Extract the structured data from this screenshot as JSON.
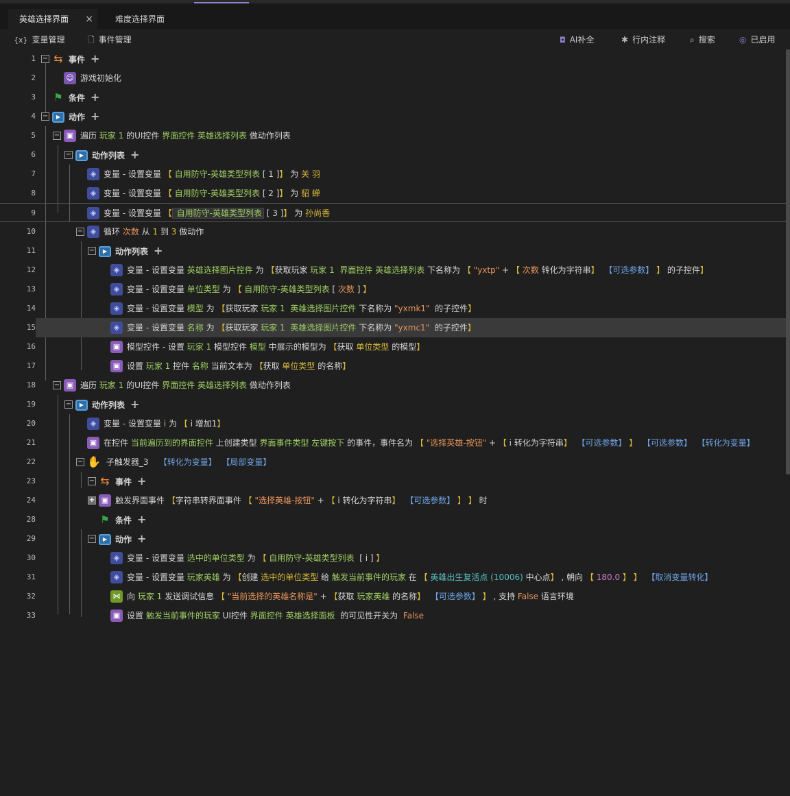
{
  "tabs": [
    {
      "label": "英雄选择界面",
      "active": true,
      "close": "×"
    },
    {
      "label": "难度选择界面",
      "active": false
    }
  ],
  "toolbar": {
    "left": [
      {
        "icon": "variable-icon",
        "glyph": "{x}",
        "label": "变量管理"
      },
      {
        "icon": "event-doc-icon",
        "glyph": "🗋",
        "label": "事件管理"
      }
    ],
    "right": [
      {
        "icon": "ai-robot-icon",
        "glyph": "🤖",
        "label": "AI补全"
      },
      {
        "icon": "asterisk-icon",
        "glyph": "✱",
        "label": "行内注释"
      },
      {
        "icon": "search-icon",
        "glyph": "🔍",
        "label": "搜索"
      },
      {
        "icon": "check-circle-icon",
        "glyph": "✓",
        "label": "已启用"
      }
    ]
  },
  "rows": [
    {
      "ln": "1",
      "depth": 0,
      "toggle": "−",
      "icon": "event",
      "bold": true,
      "add": true,
      "parts": [
        [
          "w",
          "事件"
        ]
      ]
    },
    {
      "ln": "2",
      "depth": 1,
      "icon": "user",
      "parts": [
        [
          "w",
          "游戏初始化"
        ]
      ]
    },
    {
      "ln": "3",
      "depth": 0,
      "icon": "cond",
      "bold": true,
      "add": true,
      "parts": [
        [
          "w",
          "条件"
        ]
      ]
    },
    {
      "ln": "4",
      "depth": 0,
      "toggle": "−",
      "icon": "act",
      "bold": true,
      "add": true,
      "parts": [
        [
          "w",
          "动作"
        ]
      ]
    },
    {
      "ln": "5",
      "depth": 1,
      "toggle": "−",
      "icon": "purple",
      "parts": [
        [
          "w",
          "遍历 "
        ],
        [
          "g",
          "玩家 1"
        ],
        [
          "w",
          " 的UI控件 "
        ],
        [
          "g",
          "界面控件 英雄选择列表"
        ],
        [
          "w",
          " 做动作列表"
        ]
      ]
    },
    {
      "ln": "6",
      "depth": 2,
      "toggle": "−",
      "icon": "act",
      "bold": true,
      "add": true,
      "parts": [
        [
          "w",
          "动作列表"
        ]
      ]
    },
    {
      "ln": "7",
      "depth": 3,
      "icon": "var",
      "parts": [
        [
          "w",
          "变量 - 设置变量 "
        ],
        [
          "y",
          "【"
        ],
        [
          "g",
          " 自用防守-英雄类型列表"
        ],
        [
          "w",
          " [ 1 ]"
        ],
        [
          "y",
          "】"
        ],
        [
          "w",
          " 为 "
        ],
        [
          "y",
          "关 羽"
        ]
      ]
    },
    {
      "ln": "8",
      "depth": 3,
      "icon": "var",
      "parts": [
        [
          "w",
          "变量 - 设置变量 "
        ],
        [
          "y",
          "【"
        ],
        [
          "g",
          " 自用防守-英雄类型列表"
        ],
        [
          "w",
          " [ 2 ]"
        ],
        [
          "y",
          "】"
        ],
        [
          "w",
          " 为 "
        ],
        [
          "y",
          "貂 蝉"
        ]
      ]
    },
    {
      "ln": "9",
      "depth": 3,
      "icon": "var",
      "hover": true,
      "parts": [
        [
          "w",
          "变量 - 设置变量 "
        ],
        [
          "y",
          "【"
        ],
        [
          "g",
          "hl: 自用防守-英雄类型列表"
        ],
        [
          "w",
          " [ 3 ]"
        ],
        [
          "y",
          "】"
        ],
        [
          "w",
          " 为 "
        ],
        [
          "y",
          "孙尚香"
        ]
      ]
    },
    {
      "ln": "10",
      "depth": 3,
      "toggle": "−",
      "icon": "var",
      "parts": [
        [
          "w",
          "循环 "
        ],
        [
          "o",
          "次数"
        ],
        [
          "w",
          " 从 "
        ],
        [
          "y",
          "1"
        ],
        [
          "w",
          " 到 "
        ],
        [
          "y",
          "3"
        ],
        [
          "w",
          " 做动作"
        ]
      ]
    },
    {
      "ln": "11",
      "depth": 4,
      "toggle": "−",
      "icon": "act",
      "bold": true,
      "add": true,
      "parts": [
        [
          "w",
          "动作列表"
        ]
      ]
    },
    {
      "ln": "12",
      "depth": 5,
      "icon": "var",
      "parts": [
        [
          "w",
          "变量 - 设置变量 "
        ],
        [
          "g",
          "英雄选择图片控件"
        ],
        [
          "w",
          " 为 "
        ],
        [
          "y",
          "【"
        ],
        [
          "w",
          "获取玩家 "
        ],
        [
          "g",
          "玩家 1"
        ],
        [
          "w",
          "  "
        ],
        [
          "g",
          "界面控件 英雄选择列表"
        ],
        [
          "w",
          " 下名称为 "
        ],
        [
          "y",
          "【"
        ],
        [
          "o",
          " \"yxtp\""
        ],
        [
          "w",
          " + "
        ],
        [
          "y",
          "【"
        ],
        [
          "o",
          " 次数"
        ],
        [
          "w",
          " 转化为字符串"
        ],
        [
          "y",
          "】"
        ],
        [
          "b",
          "  【可选参数】"
        ],
        [
          "y",
          " 】"
        ],
        [
          "w",
          " 的子控件"
        ],
        [
          "y",
          "】"
        ]
      ]
    },
    {
      "ln": "13",
      "depth": 5,
      "icon": "var",
      "parts": [
        [
          "w",
          "变量 - 设置变量 "
        ],
        [
          "g",
          "单位类型"
        ],
        [
          "w",
          " 为 "
        ],
        [
          "y",
          "【"
        ],
        [
          "g",
          " 自用防守-英雄类型列表"
        ],
        [
          "w",
          " [ "
        ],
        [
          "o",
          "次数"
        ],
        [
          "w",
          " ]"
        ],
        [
          "y",
          " 】"
        ]
      ]
    },
    {
      "ln": "14",
      "depth": 5,
      "icon": "var",
      "parts": [
        [
          "w",
          "变量 - 设置变量 "
        ],
        [
          "g",
          "模型"
        ],
        [
          "w",
          " 为 "
        ],
        [
          "y",
          "【"
        ],
        [
          "w",
          "获取玩家 "
        ],
        [
          "g",
          "玩家 1"
        ],
        [
          "w",
          "  "
        ],
        [
          "g",
          "英雄选择图片控件"
        ],
        [
          "w",
          " 下名称为 "
        ],
        [
          "o",
          "\"yxmk1\""
        ],
        [
          "w",
          "  的子控件"
        ],
        [
          "y",
          "】"
        ]
      ]
    },
    {
      "ln": "15",
      "depth": 5,
      "icon": "var",
      "selected": true,
      "parts": [
        [
          "w",
          "变量 - 设置变量 "
        ],
        [
          "g",
          "名称"
        ],
        [
          "w",
          " 为 "
        ],
        [
          "y",
          "【"
        ],
        [
          "w",
          "获取玩家 "
        ],
        [
          "g",
          "玩家 1"
        ],
        [
          "w",
          "  "
        ],
        [
          "g",
          "英雄选择图片控件"
        ],
        [
          "w",
          " 下名称为 "
        ],
        [
          "o",
          "\"yxmc1\""
        ],
        [
          "w",
          "  的子控件"
        ],
        [
          "y",
          "】"
        ]
      ]
    },
    {
      "ln": "16",
      "depth": 5,
      "icon": "purple",
      "parts": [
        [
          "w",
          "模型控件 - 设置 "
        ],
        [
          "g",
          "玩家 1"
        ],
        [
          "w",
          " 模型控件 "
        ],
        [
          "g",
          "模型"
        ],
        [
          "w",
          " 中展示的模型为 "
        ],
        [
          "y",
          "【"
        ],
        [
          "w",
          "获取 "
        ],
        [
          "y",
          "单位类型"
        ],
        [
          "w",
          " 的模型"
        ],
        [
          "y",
          "】"
        ]
      ]
    },
    {
      "ln": "17",
      "depth": 5,
      "icon": "purple",
      "parts": [
        [
          "w",
          "设置 "
        ],
        [
          "g",
          "玩家 1"
        ],
        [
          "w",
          " 控件 "
        ],
        [
          "g",
          "名称"
        ],
        [
          "w",
          " 当前文本为 "
        ],
        [
          "y",
          "【"
        ],
        [
          "w",
          "获取 "
        ],
        [
          "y",
          "单位类型"
        ],
        [
          "w",
          " 的名称"
        ],
        [
          "y",
          "】"
        ]
      ]
    },
    {
      "ln": "18",
      "depth": 1,
      "toggle": "−",
      "icon": "purple",
      "parts": [
        [
          "w",
          "遍历 "
        ],
        [
          "g",
          "玩家 1"
        ],
        [
          "w",
          " 的UI控件 "
        ],
        [
          "g",
          "界面控件 英雄选择列表"
        ],
        [
          "w",
          " 做动作列表"
        ]
      ]
    },
    {
      "ln": "19",
      "depth": 2,
      "toggle": "−",
      "icon": "act",
      "bold": true,
      "add": true,
      "parts": [
        [
          "w",
          "动作列表"
        ]
      ]
    },
    {
      "ln": "20",
      "depth": 3,
      "icon": "var",
      "parts": [
        [
          "w",
          "变量 - 设置变量 "
        ],
        [
          "g",
          "i"
        ],
        [
          "w",
          " 为 "
        ],
        [
          "y",
          "【"
        ],
        [
          "w",
          " i 增加1"
        ],
        [
          "y",
          "】"
        ]
      ]
    },
    {
      "ln": "21",
      "depth": 3,
      "icon": "purple",
      "parts": [
        [
          "w",
          "在控件 "
        ],
        [
          "g",
          "当前遍历到的界面控件"
        ],
        [
          "w",
          " 上创建类型 "
        ],
        [
          "g",
          "界面事件类型 左键按下"
        ],
        [
          "w",
          " 的事件，事件名为 "
        ],
        [
          "y",
          "【"
        ],
        [
          "o",
          " \"选择英雄-按钮\""
        ],
        [
          "w",
          " + "
        ],
        [
          "y",
          "【"
        ],
        [
          "w",
          " i 转化为字符串"
        ],
        [
          "y",
          "】"
        ],
        [
          "b",
          "  【可选参数】"
        ],
        [
          "y",
          " 】"
        ],
        [
          "b",
          "  【可选参数】"
        ],
        [
          "b",
          "  【转化为变量】"
        ]
      ]
    },
    {
      "ln": "22",
      "depth": 3,
      "toggle": "−",
      "icon": "hand",
      "parts": [
        [
          "w",
          " 子触发器_3   "
        ],
        [
          "b",
          " 【转化为变量】"
        ],
        [
          "b",
          "  【局部变量】"
        ]
      ]
    },
    {
      "ln": "23",
      "depth": 4,
      "toggle": "−",
      "icon": "event",
      "bold": true,
      "add": true,
      "parts": [
        [
          "w",
          "事件"
        ]
      ]
    },
    {
      "ln": "24",
      "depth": 4,
      "toggle": "+",
      "icon": "purple",
      "parts": [
        [
          "w",
          "触发界面事件 "
        ],
        [
          "y",
          "【"
        ],
        [
          "w",
          "字符串转界面事件 "
        ],
        [
          "y",
          "【"
        ],
        [
          "o",
          " \"选择英雄-按钮\""
        ],
        [
          "w",
          " + "
        ],
        [
          "y",
          "【"
        ],
        [
          "w",
          " i 转化为字符串"
        ],
        [
          "y",
          "】"
        ],
        [
          "b",
          "  【可选参数】"
        ],
        [
          "y",
          " 】"
        ],
        [
          "y",
          " 】"
        ],
        [
          "w",
          " 时"
        ]
      ]
    },
    {
      "ln": "28",
      "depth": 4,
      "icon": "cond",
      "bold": true,
      "add": true,
      "parts": [
        [
          "w",
          "条件"
        ]
      ]
    },
    {
      "ln": "29",
      "depth": 4,
      "toggle": "−",
      "icon": "act",
      "bold": true,
      "add": true,
      "parts": [
        [
          "w",
          "动作"
        ]
      ]
    },
    {
      "ln": "30",
      "depth": 5,
      "icon": "var",
      "parts": [
        [
          "w",
          "变量 - 设置变量 "
        ],
        [
          "g",
          "选中的单位类型"
        ],
        [
          "w",
          " 为 "
        ],
        [
          "y",
          "【"
        ],
        [
          "g",
          " 自用防守-英雄类型列表"
        ],
        [
          "w",
          "  [ i ]"
        ],
        [
          "y",
          " 】"
        ]
      ]
    },
    {
      "ln": "31",
      "depth": 5,
      "icon": "var",
      "parts": [
        [
          "w",
          "变量 - 设置变量 "
        ],
        [
          "g",
          "玩家英雄"
        ],
        [
          "w",
          " 为 "
        ],
        [
          "y",
          "【"
        ],
        [
          "w",
          "创建 "
        ],
        [
          "y",
          "选中的单位类型"
        ],
        [
          "w",
          " 给 "
        ],
        [
          "g",
          "触发当前事件的玩家"
        ],
        [
          "w",
          " 在 "
        ],
        [
          "y",
          "【"
        ],
        [
          "t",
          " 英雄出生复活点 (10006)"
        ],
        [
          "w",
          " 中心点"
        ],
        [
          "y",
          "】"
        ],
        [
          "w",
          " , 朝向 "
        ],
        [
          "y",
          "【"
        ],
        [
          "m",
          " 180.0"
        ],
        [
          "y",
          " 】"
        ],
        [
          "y",
          " 】"
        ],
        [
          "b",
          "  【取消变量转化】"
        ]
      ]
    },
    {
      "ln": "32",
      "depth": 5,
      "icon": "green",
      "parts": [
        [
          "w",
          "向 "
        ],
        [
          "g",
          "玩家 1"
        ],
        [
          "w",
          " 发送调试信息 "
        ],
        [
          "y",
          "【"
        ],
        [
          "o",
          " \"当前选择的英雄名称是\""
        ],
        [
          "w",
          " + "
        ],
        [
          "y",
          "【"
        ],
        [
          "w",
          "获取 "
        ],
        [
          "g",
          "玩家英雄"
        ],
        [
          "w",
          " 的名称"
        ],
        [
          "y",
          "】"
        ],
        [
          "b",
          "  【可选参数】"
        ],
        [
          "y",
          " 】"
        ],
        [
          "w",
          " , 支持 "
        ],
        [
          "o",
          "False"
        ],
        [
          "w",
          " 语言环境"
        ]
      ]
    },
    {
      "ln": "33",
      "depth": 5,
      "icon": "purple",
      "parts": [
        [
          "w",
          "设置 "
        ],
        [
          "g",
          "触发当前事件的玩家"
        ],
        [
          "w",
          " UI控件 "
        ],
        [
          "g",
          "界面控件 英雄选择面板"
        ],
        [
          "w",
          "  的可见性开关为  "
        ],
        [
          "o",
          "False"
        ]
      ]
    }
  ]
}
